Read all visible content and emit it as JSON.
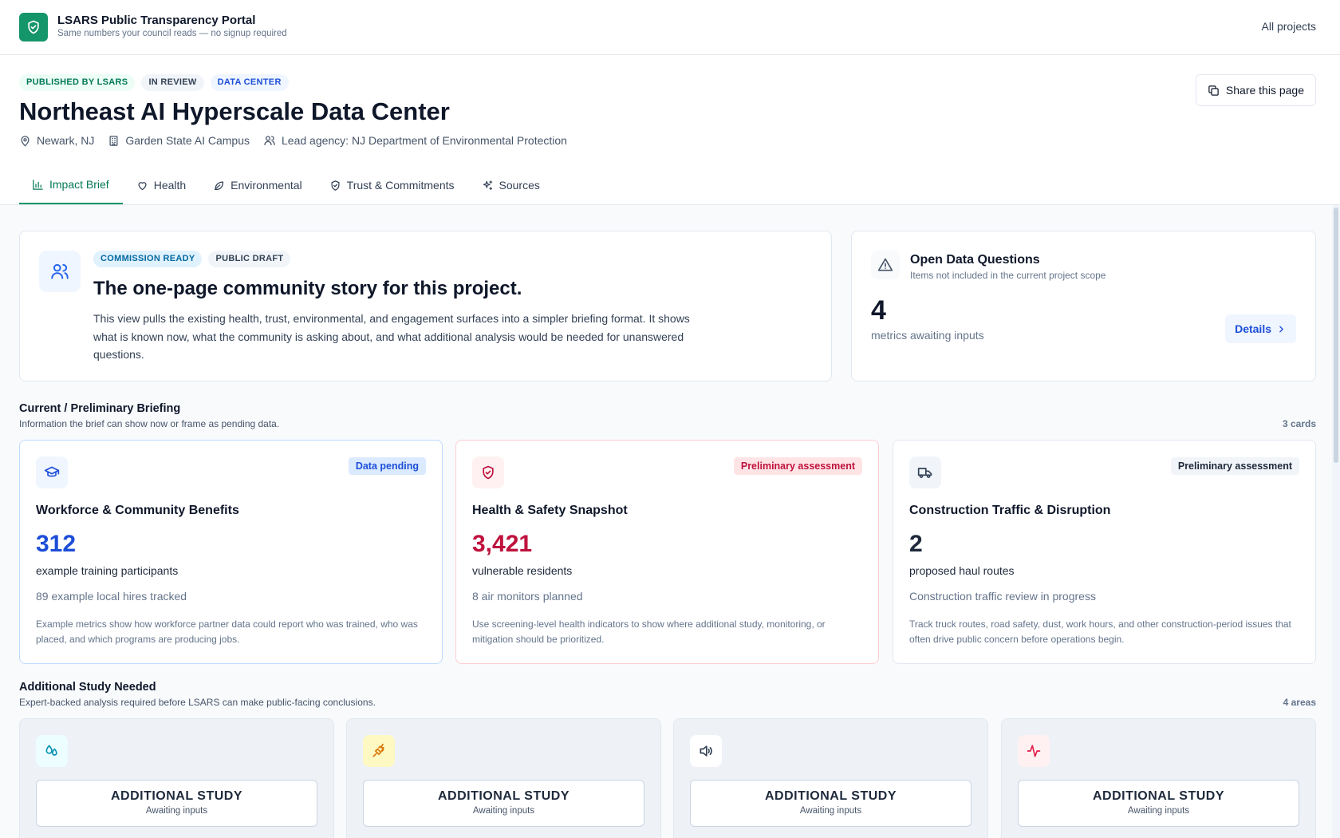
{
  "topbar": {
    "brand_title": "LSARS Public Transparency Portal",
    "brand_subtitle": "Same numbers your council reads — no signup required",
    "all_projects_label": "All projects",
    "logo_icon": "shield-check-icon",
    "brand_color": "#15956a"
  },
  "project": {
    "chips": [
      "PUBLISHED BY LSARS",
      "IN REVIEW",
      "DATA CENTER"
    ],
    "title": "Northeast AI Hyperscale Data Center",
    "location": "Newark, NJ",
    "campus": "Garden State AI Campus",
    "lead_agency": "Lead agency: NJ Department of Environmental Protection",
    "share_label": "Share this page"
  },
  "tabs": [
    {
      "label": "Impact Brief",
      "icon": "bar-chart-icon",
      "active": true
    },
    {
      "label": "Health",
      "icon": "heart-icon",
      "active": false
    },
    {
      "label": "Environmental",
      "icon": "leaf-icon",
      "active": false
    },
    {
      "label": "Trust & Commitments",
      "icon": "shield-icon",
      "active": false
    },
    {
      "label": "Sources",
      "icon": "sparkles-icon",
      "active": false
    }
  ],
  "story": {
    "chips": [
      "COMMISSION READY",
      "PUBLIC DRAFT"
    ],
    "title": "The one-page community story for this project.",
    "body": "This view pulls the existing health, trust, environmental, and engagement surfaces into a simpler briefing format. It shows what is known now, what the community is asking about, and what additional analysis would be needed for unanswered questions."
  },
  "open_questions": {
    "title": "Open Data Questions",
    "subtitle": "Items not included in the current project scope",
    "count": "4",
    "count_label": "metrics awaiting inputs",
    "details_label": "Details"
  },
  "briefing": {
    "title": "Current / Preliminary Briefing",
    "subtitle": "Information the brief can show now or frame as pending data.",
    "count": "3 cards",
    "cards": [
      {
        "icon": "graduation-cap-icon",
        "badge": "Data pending",
        "title": "Workforce & Community Benefits",
        "value": "312",
        "value_label": "example training participants",
        "secondary": "89 example local hires tracked",
        "description": "Example metrics show how workforce partner data could report who was trained, who was placed, and which programs are producing jobs.",
        "accent": "#1d4ed8"
      },
      {
        "icon": "shield-check-icon",
        "badge": "Preliminary assessment",
        "title": "Health & Safety Snapshot",
        "value": "3,421",
        "value_label": "vulnerable residents",
        "secondary": "8 air monitors planned",
        "description": "Use screening-level health indicators to show where additional study, monitoring, or mitigation should be prioritized.",
        "accent": "#be123c"
      },
      {
        "icon": "truck-icon",
        "badge": "Preliminary assessment",
        "title": "Construction Traffic & Disruption",
        "value": "2",
        "value_label": "proposed haul routes",
        "secondary": "Construction traffic review in progress",
        "description": "Track truck routes, road safety, dust, work hours, and other construction-period issues that often drive public concern before operations begin.",
        "accent": "#1e293b"
      }
    ]
  },
  "additional": {
    "title": "Additional Study Needed",
    "subtitle": "Expert-backed analysis required before LSARS can make public-facing conclusions.",
    "count": "4 areas",
    "cards": [
      {
        "icon": "droplets-icon",
        "box_title": "ADDITIONAL STUDY",
        "box_sub": "Awaiting inputs"
      },
      {
        "icon": "plug-zap-icon",
        "box_title": "ADDITIONAL STUDY",
        "box_sub": "Awaiting inputs"
      },
      {
        "icon": "volume-icon",
        "box_title": "ADDITIONAL STUDY",
        "box_sub": "Awaiting inputs"
      },
      {
        "icon": "activity-icon",
        "box_title": "ADDITIONAL STUDY",
        "box_sub": "Awaiting inputs"
      }
    ]
  }
}
